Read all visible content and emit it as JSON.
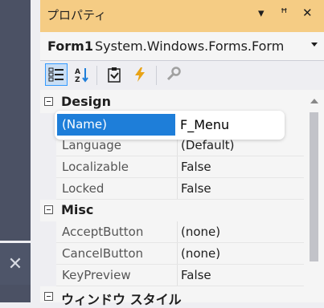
{
  "side": {
    "close_glyph": "✕"
  },
  "panel": {
    "title": "プロパティ",
    "title_icons": [
      "▾",
      "ꟸ",
      "✕"
    ]
  },
  "object_selector": {
    "name": "Form1",
    "type": "System.Windows.Forms.Form"
  },
  "toolbar": {
    "buttons": [
      {
        "icon": "categorized-icon",
        "active": true
      },
      {
        "icon": "alphabetical-icon",
        "active": false
      },
      {
        "icon": "properties-icon",
        "active": false
      },
      {
        "icon": "events-icon",
        "active": false
      },
      {
        "icon": "property-pages-icon",
        "active": false
      }
    ]
  },
  "grid": {
    "categories": [
      {
        "name": "Design",
        "properties": [
          {
            "name": "(Name)",
            "value": "F_Menu"
          },
          {
            "name": "Language",
            "value": "(Default)"
          },
          {
            "name": "Localizable",
            "value": "False"
          },
          {
            "name": "Locked",
            "value": "False"
          }
        ]
      },
      {
        "name": "Misc",
        "properties": [
          {
            "name": "AcceptButton",
            "value": "(none)"
          },
          {
            "name": "CancelButton",
            "value": "(none)"
          },
          {
            "name": "KeyPreview",
            "value": "False"
          }
        ]
      },
      {
        "name": "ウィンドウ スタイル",
        "properties": []
      }
    ]
  },
  "colors": {
    "title_bar": "#f5cc84",
    "selection": "#1e7ed9",
    "side_dark": "#4b5164"
  }
}
